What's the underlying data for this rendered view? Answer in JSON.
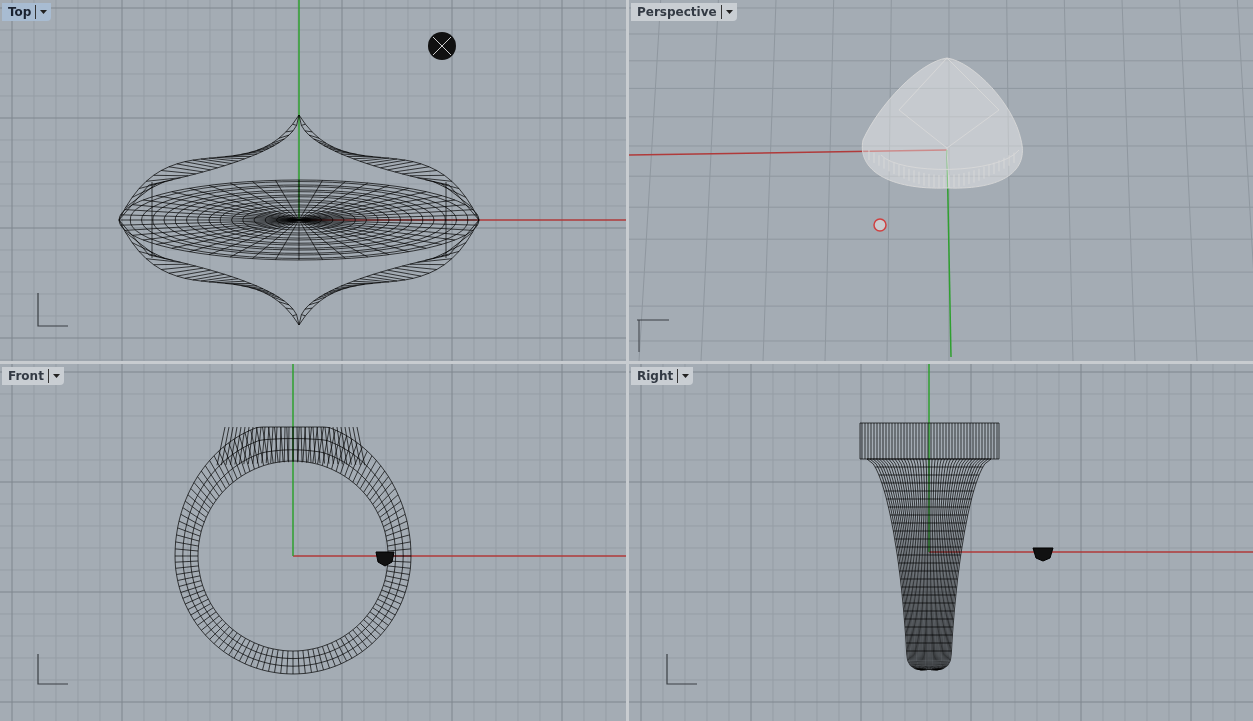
{
  "viewports": [
    {
      "title": "Top",
      "selected": true,
      "kind": "top"
    },
    {
      "title": "Perspective",
      "selected": false,
      "kind": "perspective"
    },
    {
      "title": "Front",
      "selected": false,
      "kind": "front"
    },
    {
      "title": "Right",
      "selected": false,
      "kind": "right"
    }
  ]
}
